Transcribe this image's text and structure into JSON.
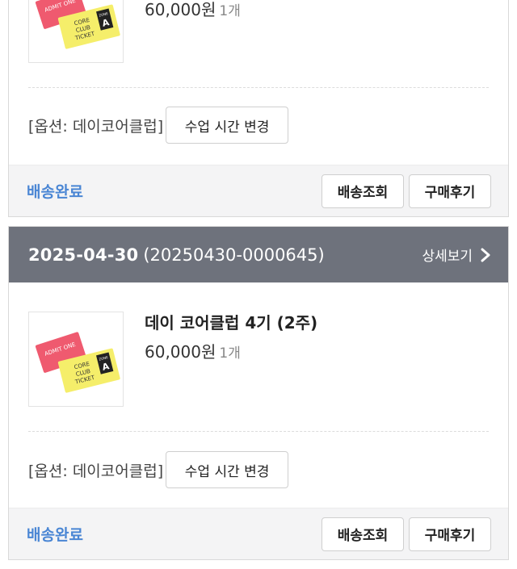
{
  "orders": [
    {
      "product": {
        "price": "60,000원",
        "qty": "1개"
      },
      "option": "[옵션: 데이코어클럽]",
      "change_btn": "수업 시간 변경",
      "status": "배송완료",
      "track_btn": "배송조회",
      "review_btn": "구매후기"
    },
    {
      "date": "2025-04-30",
      "order_no": "(20250430-0000645)",
      "detail_label": "상세보기",
      "product": {
        "name": "데이 코어클럽 4기 (2주)",
        "price": "60,000원",
        "qty": "1개"
      },
      "option": "[옵션: 데이코어클럽]",
      "change_btn": "수업 시간 변경",
      "status": "배송완료",
      "track_btn": "배송조회",
      "review_btn": "구매후기"
    }
  ],
  "ticket": {
    "admit": "ADMIT ONE",
    "core": "CORE",
    "club": "CLUB",
    "ticket": "TICKET",
    "zone": "ZONE",
    "zone_letter": "A"
  },
  "colors": {
    "header_bg": "#6e727c",
    "status_blue": "#4a86d4",
    "ticket_pink": "#ef5a6f",
    "ticket_yellow": "#f5ee6a"
  },
  "icons": {
    "detail": "chevron-right-icon",
    "thumbnail": "ticket-image"
  }
}
